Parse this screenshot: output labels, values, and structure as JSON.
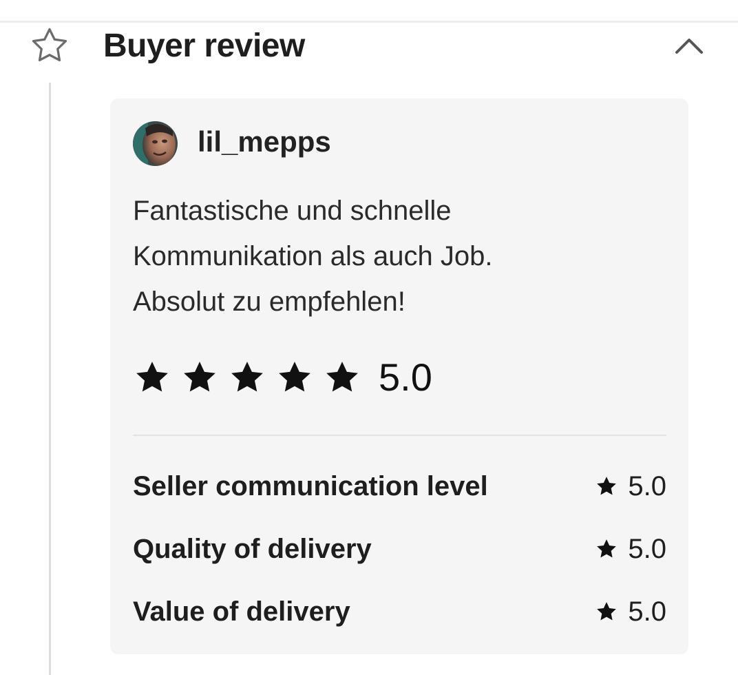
{
  "section": {
    "title": "Buyer review",
    "icon": "star-outline-icon",
    "toggle_icon": "chevron-up-icon"
  },
  "review": {
    "reviewer": {
      "name": "lil_mepps",
      "avatar": "user-avatar"
    },
    "text_lines": [
      "Fantastische und schnelle",
      "Kommunikation als auch Job.",
      "Absolut zu empfehlen!"
    ],
    "overall_rating": {
      "stars_filled": 5,
      "stars_total": 5,
      "value": "5.0"
    },
    "criteria": [
      {
        "label": "Seller communication level",
        "value": "5.0"
      },
      {
        "label": "Quality of delivery",
        "value": "5.0"
      },
      {
        "label": "Value of delivery",
        "value": "5.0"
      }
    ]
  },
  "colors": {
    "card_background": "#f5f5f5",
    "star_fill": "#111111",
    "divider": "#e2e2e2",
    "timeline": "#dcdcdc"
  }
}
